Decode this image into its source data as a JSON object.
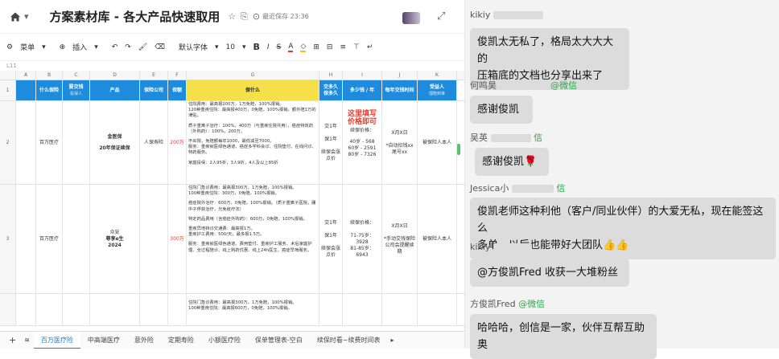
{
  "sheet": {
    "doc_title": "方案素材库 - 各大产品快速取用",
    "saved_text": "最近保存 23:36",
    "toolbar": {
      "menu": "菜单",
      "insert": "插入",
      "font": "默认字体",
      "size": "10"
    },
    "cell_ref": "L11",
    "columns": [
      "A",
      "B",
      "C",
      "D",
      "E",
      "F",
      "G",
      "H",
      "I",
      "J",
      "K"
    ],
    "header": {
      "b": "什么保险",
      "c": "要交钱",
      "c_sub": "投保人",
      "d": "产品",
      "e": "保险公司",
      "f": "保额",
      "g": "保什么",
      "h": "交多久",
      "h_sub": "保多久",
      "i": "多少钱 / 年",
      "j": "每年交钱时间",
      "k": "受益人",
      "k_sub": "理赔到谁"
    },
    "rows": [
      {
        "num": "2",
        "b": "百万医疗",
        "d1": "金医保",
        "d2": "20年保证续保",
        "e": "人保寿险",
        "f": "200万",
        "g": [
          "住院费用：最高报200万，1万免赔，100%报销。",
          "120种重疾住院：最高报400万，0免赔，100%报销，额外赔1万的津贴。",
          "质子重离子治疗：100%，400万（与重疾住院共用），癌症特效药（外购药）：100%，200万。",
          "不出院，免赔额每年1000，最低减至7000。",
          "服务：重疾就医绿色通道、癌症多学科会诊、住院垫付、在线问诊、特药服务。",
          "家庭投保：2人95折，3人9折，4人及以上85折"
        ],
        "h1": "交1年",
        "h2": "保1年",
        "h3": "续保会涨点价",
        "i_note1": "这里填写",
        "i_note2": "价格即可",
        "i_lines": [
          "续保价格：",
          "40岁 - 568",
          "60岁 - 2591",
          "80岁 - 7326"
        ],
        "j1": "X月X日",
        "j2": "*自动扣钱xx尾号xx",
        "k": "被保险人本人"
      },
      {
        "num": "3",
        "b": "百万医疗",
        "d1": "众安",
        "d2": "尊享e生",
        "d3": "2024",
        "e": "",
        "f": "300万",
        "g": [
          "住院门急诊费用：最高报300万，1万免赔，100%报销。",
          "100种重疾住院：300万，0免赔，100%报销。",
          "癌症院外治疗：600万，0免赔，100%报销。（质子重离子医院，硼中子俘获治疗，光免疫疗法）",
          "特定药品费用（含癌症外购药）：600万，0免赔，100%报销。",
          "重疾异地转诊交通费：最高报1万。",
          "重疾护工费用：500/天，最多报1.5万。",
          "服务：重疾就医绿色通道、费用垫付、重疾护工服务、术后家庭护理、全过程陪诊、线上购药优惠、线上24h医生、癌症早筛服务。"
        ],
        "h1": "交1年",
        "h2": "保1年",
        "h3": "续保会涨点价",
        "i_lines": [
          "续保价格：",
          "71-75岁：3928",
          "81-85岁：6943"
        ],
        "j1": "X月X日",
        "j2": "*手动交钱保险公司会提醒续期",
        "k": "被保险人本人"
      },
      {
        "num": "",
        "g": [
          "住院门急诊费用：最高报300万，1万免赔，100%报销。",
          "100种重疾住院：最高报600万，0免赔，100%报销。"
        ]
      }
    ],
    "tabs": [
      "百万医疗险",
      "中高端医疗",
      "意外险",
      "定期寿险",
      "小额医疗险",
      "保单管理表-空白",
      "续保时看~续费时间表"
    ]
  },
  "chat": {
    "messages": [
      {
        "sender": "kikiy",
        "org": "",
        "text_lines": [
          "俊凯太无私了，格局太大大大的",
          "压箱底的文档也分享出来了"
        ]
      },
      {
        "sender": "何鸣昊",
        "org": "@微信",
        "text_lines": [
          "感谢俊凯"
        ]
      },
      {
        "sender": "吴英",
        "org": "信",
        "text_lines": [
          "感谢俊凯🌹"
        ]
      },
      {
        "sender": "Jessica小",
        "org": "信",
        "text_lines": [
          "俊凯老师这种利他（客户/同业伙伴）的大爱无私，现在能签这么",
          "多单，以后也能带好大团队👍👍"
        ]
      },
      {
        "sender": "kikiy",
        "org": "",
        "text_lines": [
          "@方俊凯Fred  收获一大堆粉丝"
        ]
      },
      {
        "sender": "方俊凯Fred",
        "org": "@微信",
        "text_lines": [
          "哈哈哈，创信是一家，伙伴互帮互助奥"
        ]
      }
    ]
  }
}
